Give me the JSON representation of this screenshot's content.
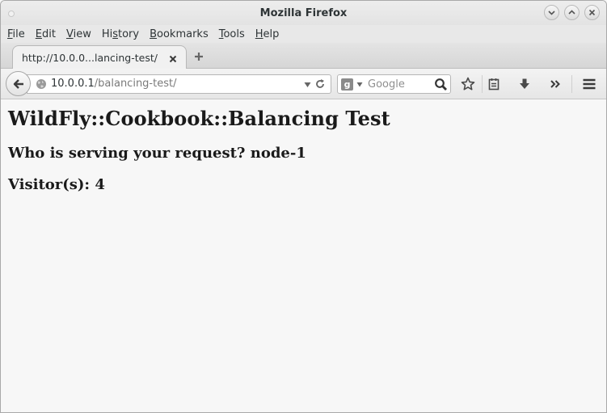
{
  "window": {
    "title": "Mozilla Firefox"
  },
  "menu": [
    {
      "accel": "F",
      "rest": "ile"
    },
    {
      "accel": "E",
      "rest": "dit"
    },
    {
      "accel": "V",
      "rest": "iew"
    },
    {
      "pre": "Hi",
      "accel": "s",
      "rest": "tory"
    },
    {
      "accel": "B",
      "rest": "ookmarks"
    },
    {
      "accel": "T",
      "rest": "ools"
    },
    {
      "accel": "H",
      "rest": "elp"
    }
  ],
  "tab": {
    "label": "http://10.0.0...lancing-test/"
  },
  "urlbar": {
    "host": "10.0.0.1",
    "path": "/balancing-test/"
  },
  "search": {
    "placeholder": "Google",
    "engine_letter": "g"
  },
  "page": {
    "heading": "WildFly::Cookbook::Balancing Test",
    "serving_text": "Who is serving your request? node-1",
    "visitors_text": "Visitor(s): 4"
  },
  "icons": [
    "window-icon",
    "minimize-icon",
    "maximize-icon",
    "close-icon",
    "tab-close-icon",
    "new-tab-icon",
    "back-arrow-icon",
    "globe-icon",
    "dropdown-arrow-icon",
    "reload-icon",
    "search-engine-icon",
    "magnifier-icon",
    "star-icon",
    "reading-list-icon",
    "download-icon",
    "overflow-chevron-icon",
    "hamburger-menu-icon"
  ]
}
